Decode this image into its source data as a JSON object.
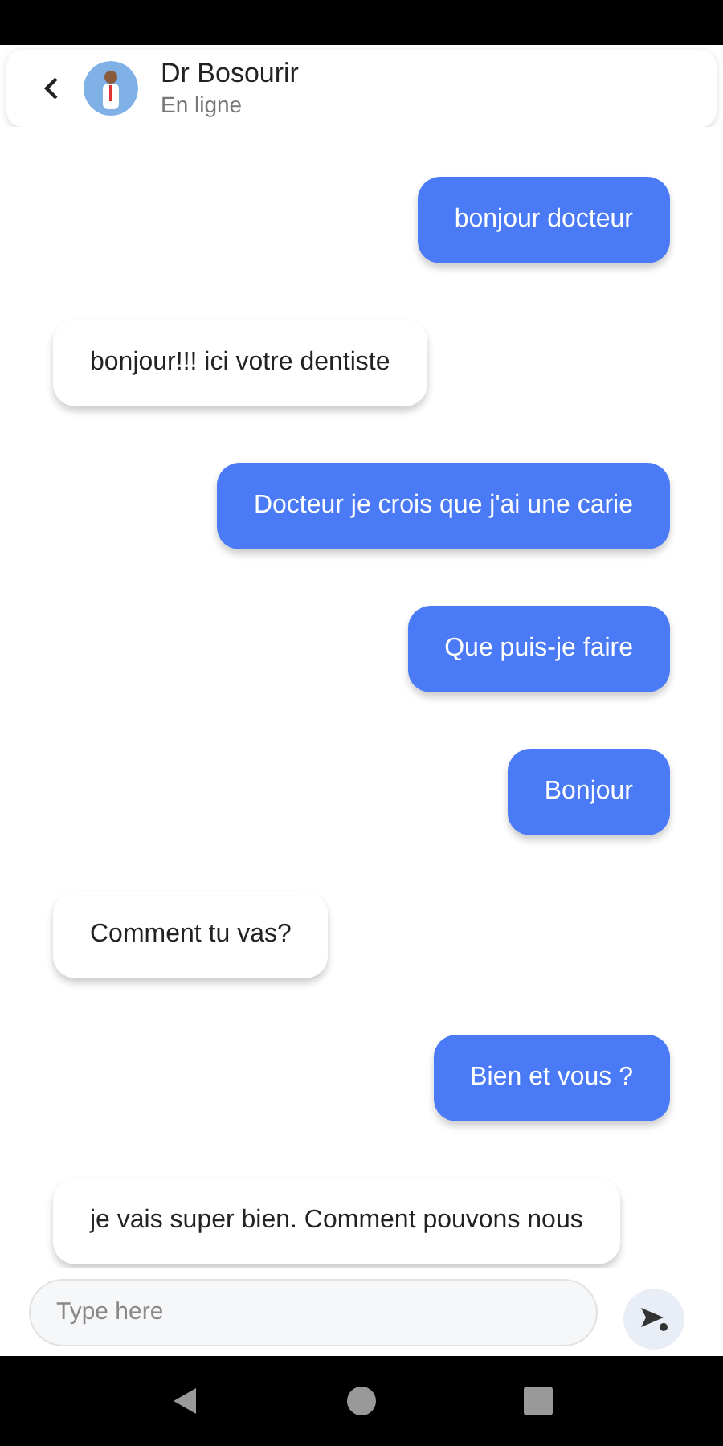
{
  "header": {
    "title": "Dr Bosourir",
    "status": "En ligne"
  },
  "messages": [
    {
      "kind": "sent",
      "text": "bonjour docteur"
    },
    {
      "kind": "received",
      "text": "bonjour!!! ici votre dentiste"
    },
    {
      "kind": "sent",
      "text": "Docteur je crois que j'ai une carie"
    },
    {
      "kind": "sent",
      "text": "Que puis-je faire"
    },
    {
      "kind": "sent",
      "text": "Bonjour"
    },
    {
      "kind": "received",
      "text": "Comment tu vas?"
    },
    {
      "kind": "sent",
      "text": "Bien et vous ?"
    },
    {
      "kind": "received",
      "text": "je vais super bien. Comment pouvons nous"
    }
  ],
  "composer": {
    "placeholder": "Type here"
  }
}
